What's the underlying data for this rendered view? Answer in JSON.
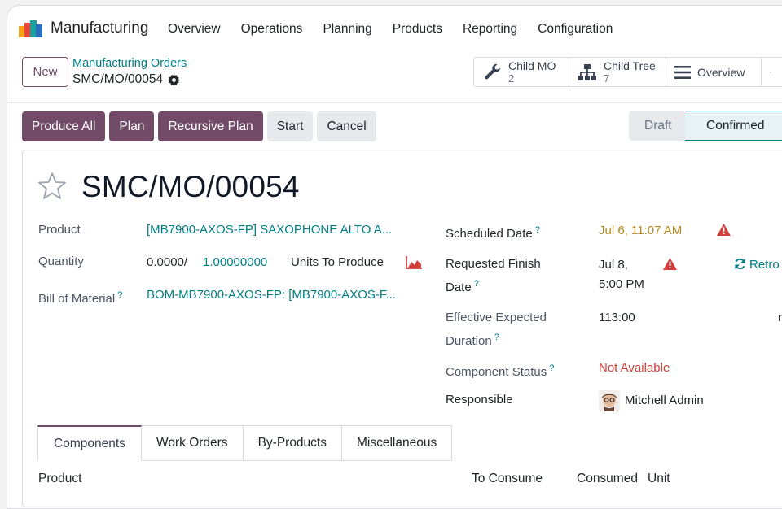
{
  "navbar": {
    "app_name": "Manufacturing",
    "menu": [
      "Overview",
      "Operations",
      "Planning",
      "Products",
      "Reporting",
      "Configuration"
    ]
  },
  "control": {
    "new_label": "New",
    "breadcrumb_parent": "Manufacturing Orders",
    "breadcrumb_current": "SMC/MO/00054"
  },
  "smart_buttons": {
    "child_mo": {
      "label": "Child MO",
      "count": "2"
    },
    "child_tree": {
      "label": "Child Tree",
      "count": "7"
    },
    "overview": {
      "label": "Overview"
    }
  },
  "actions": [
    "Produce All",
    "Plan",
    "Recursive Plan",
    "Start",
    "Cancel"
  ],
  "stages": {
    "draft": "Draft",
    "confirmed": "Confirmed",
    "current": "Confirmed"
  },
  "record": {
    "title": "SMC/MO/00054",
    "product_label": "Product",
    "product_value": "[MB7900-AXOS-FP] SAXOPHONE ALTO A...",
    "quantity_label": "Quantity",
    "quantity_produced": "0.0000/",
    "quantity_to_produce": "1.00000000",
    "quantity_unit": "Units To Produce",
    "bom_label": "Bill of Material",
    "bom_value": "BOM-MB7900-AXOS-FP: [MB7900-AXOS-F...",
    "scheduled_label": "Scheduled Date",
    "scheduled_value": "Jul 6, 11:07 AM",
    "finish_label_1": "Requested Finish",
    "finish_label_2": "Date",
    "finish_value_1": "Jul 8,",
    "finish_value_2": "5:00 PM",
    "retro_label": "Retro",
    "duration_label_1": "Effective Expected",
    "duration_label_2": "Duration",
    "duration_value": "113:00",
    "duration_unit": "r",
    "component_status_label": "Component Status",
    "component_status_value": "Not Available",
    "responsible_label": "Responsible",
    "responsible_value": "Mitchell Admin"
  },
  "tabs": [
    "Components",
    "Work Orders",
    "By-Products",
    "Miscellaneous"
  ],
  "table_columns": {
    "product": "Product",
    "to_consume": "To Consume",
    "consumed": "Consumed",
    "unit": "Unit"
  },
  "colors": {
    "brand": "#714b67",
    "link": "#017e84",
    "danger": "#d23f3a",
    "warning": "#b5871f"
  }
}
